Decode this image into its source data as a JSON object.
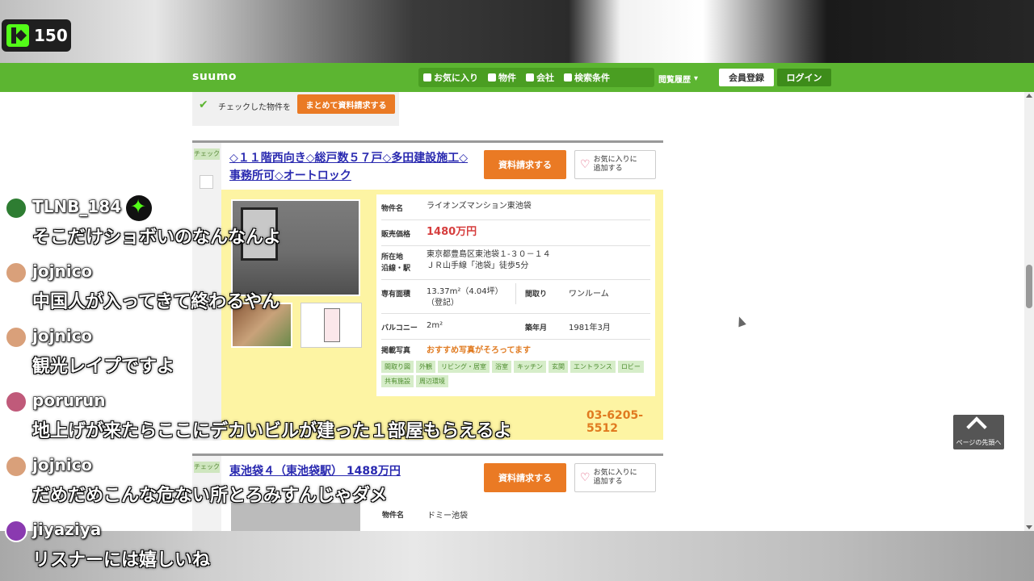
{
  "stream": {
    "viewer_count": "150"
  },
  "header": {
    "logo": "suumo",
    "nav": [
      "お気に入り",
      "物件",
      "会社",
      "検索条件"
    ],
    "history": "閲覧履歴",
    "register": "会員登録",
    "login": "ログイン"
  },
  "bulk": {
    "check_mark": "✔",
    "text": "チェックした物件を",
    "button": "まとめて資料請求する"
  },
  "listing1": {
    "check_label": "チェック",
    "title": "◇１１階西向き◇総戸数５７戸◇多田建設施工◇事務所可◇オートロック",
    "request_btn": "資料請求する",
    "fav_btn_l1": "お気に入りに",
    "fav_btn_l2": "追加する",
    "name_k": "物件名",
    "name_v": "ライオンズマンション東池袋",
    "price_k": "販売価格",
    "price_v": "1480万円",
    "addr_k": "所在地",
    "addr_v": "東京都豊島区東池袋１-３０－１４",
    "line_k": "沿線・駅",
    "line_v": "ＪＲ山手線「池袋」徒歩5分",
    "area_k": "専有面積",
    "area_v": "13.37m²（4.04坪）",
    "area_v2": "（登記）",
    "layout_k": "間取り",
    "layout_v": "ワンルーム",
    "balcony_k": "バルコニー",
    "balcony_v": "2m²",
    "built_k": "築年月",
    "built_v": "1981年3月",
    "photos_k": "掲載写真",
    "photos_reco": "おすすめ写真がそろってます",
    "tags": [
      "間取り図",
      "外観",
      "リビング・居室",
      "浴室",
      "キッチン",
      "玄関",
      "エントランス",
      "ロビー",
      "共有施設",
      "周辺環境"
    ],
    "phone": "03-6205-5512"
  },
  "listing2": {
    "check_label": "チェック",
    "title": "東池袋４（東池袋駅） 1488万円",
    "request_btn": "資料請求する",
    "fav_btn_l1": "お気に入りに",
    "fav_btn_l2": "追加する",
    "name_k": "物件名",
    "name_v": "ドミー池袋"
  },
  "page_top": "ページの先頭へ",
  "chat": [
    {
      "user": "TLNB_184",
      "text": "そこだけショボいのなんなんよ",
      "avatar_color": "#2e7d32"
    },
    {
      "user": "jojnico",
      "text": "中国人が入ってきて終わるやん",
      "avatar_color": "#d9a07a"
    },
    {
      "user": "jojnico",
      "text": "観光レイプですよ",
      "avatar_color": "#d9a07a"
    },
    {
      "user": "porurun",
      "text": "地上げが来たらここにデカいビルが建った１部屋もらえるよ",
      "avatar_color": "#c05a7a"
    },
    {
      "user": "jojnico",
      "text": "だめだめこんな危ない所とろみすんじゃダメ",
      "avatar_color": "#d9a07a"
    },
    {
      "user": "jiyaziya",
      "text": "リスナーには嬉しいね",
      "avatar_color": "#8a3ab0"
    }
  ]
}
